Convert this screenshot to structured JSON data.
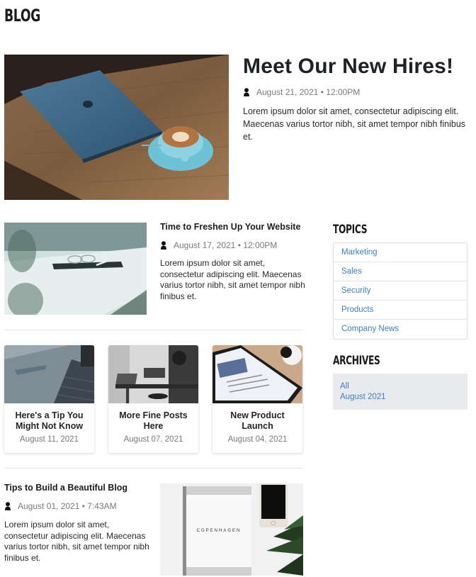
{
  "page": {
    "title": "BLOG"
  },
  "featured": {
    "title": "Meet Our New Hires!",
    "date": "August 21, 2021 • 12:00PM",
    "excerpt": "Lorem ipsum dolor sit amet, consectetur adipiscing elit. Maecenas varius tortor nibh, sit amet tempor nibh finibus et.",
    "image_icon": "laptop-coffee-photo"
  },
  "posts": [
    {
      "title": "Time to Freshen Up Your Website",
      "date": "August 17, 2021 • 12:00PM",
      "excerpt": "Lorem ipsum dolor sit amet, consectetur adipiscing elit. Maecenas varius tortor nibh, sit amet tempor nibh finibus et.",
      "image_icon": "glasses-tablet-photo"
    },
    {
      "title": "Tips to Build a Beautiful Blog",
      "date": "August 01, 2021 • 7:43AM",
      "excerpt": "Lorem ipsum dolor sit amet, consectetur adipiscing elit. Maecenas varius tortor nibh, sit amet tempor nibh finibus et.",
      "image_icon": "notebook-phone-photo",
      "image_caption": "COPENHAGEN"
    }
  ],
  "cards": [
    {
      "title": "Here's a Tip You Might Not Know",
      "date": "August 11, 2021",
      "image_icon": "laptop-keyboard-photo"
    },
    {
      "title": "More Fine Posts Here",
      "date": "August 07, 2021",
      "image_icon": "office-workers-photo"
    },
    {
      "title": "New Product Launch",
      "date": "August 04, 2021",
      "image_icon": "smartphone-photo"
    }
  ],
  "sidebar": {
    "topics_heading": "TOPICS",
    "topics": [
      "Marketing",
      "Sales",
      "Security",
      "Products",
      "Company News"
    ],
    "archives_heading": "ARCHIVES",
    "archives": [
      "All",
      "August 2021"
    ]
  },
  "colors": {
    "link": "#3f7fc1",
    "archives_bg": "#e9eaee",
    "heading": "#1e2125",
    "meta": "#7a7a7a"
  }
}
